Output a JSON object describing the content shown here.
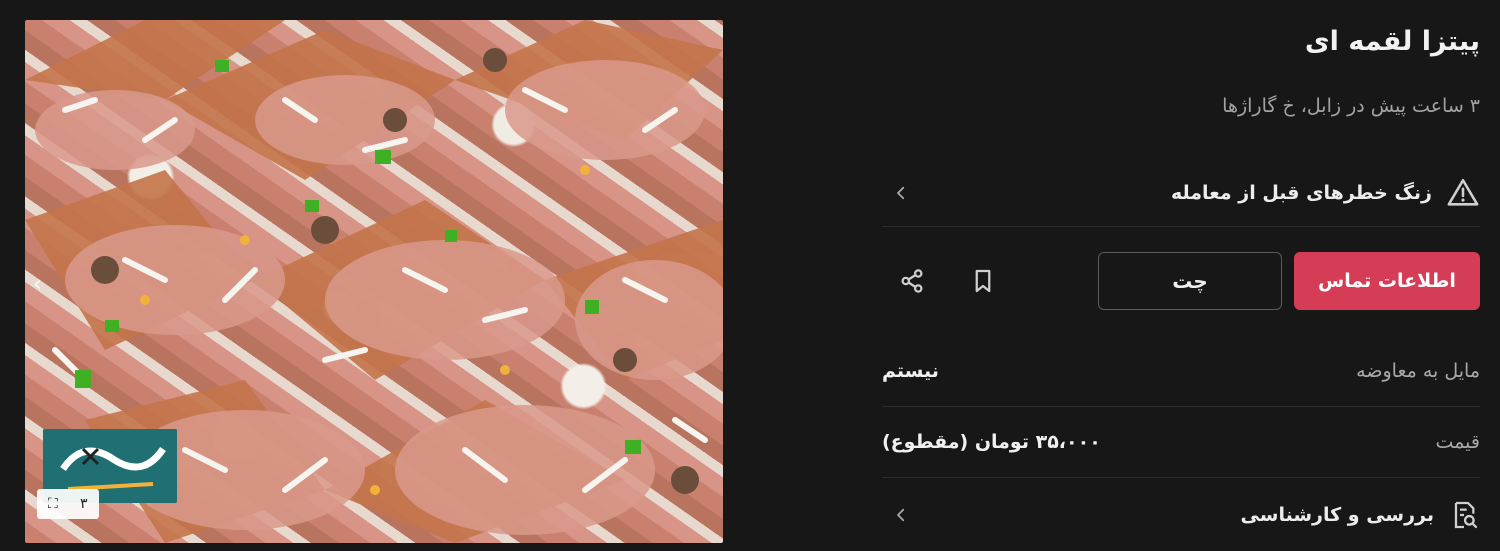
{
  "gallery": {
    "image_alt": "pizza-bites-photo",
    "counter": "۳"
  },
  "listing": {
    "title": "پیتزا لقمه ای",
    "subtitle": "۳ ساعت پیش در زابل، خ گاراژها"
  },
  "warning": {
    "label": "زنگ خطرهای قبل از معامله"
  },
  "actions": {
    "contact_label": "اطلاعات تماس",
    "chat_label": "چت"
  },
  "details": {
    "exchange_label": "مایل به معاوضه",
    "exchange_value": "نیستم",
    "price_label": "قیمت",
    "price_value": "۳۵،۰۰۰ تومان (مقطوع)"
  },
  "review": {
    "label": "بررسی و کارشناسی"
  },
  "colors": {
    "background": "#171717",
    "accent": "#d43d55",
    "muted_text": "#a3a3a3"
  }
}
